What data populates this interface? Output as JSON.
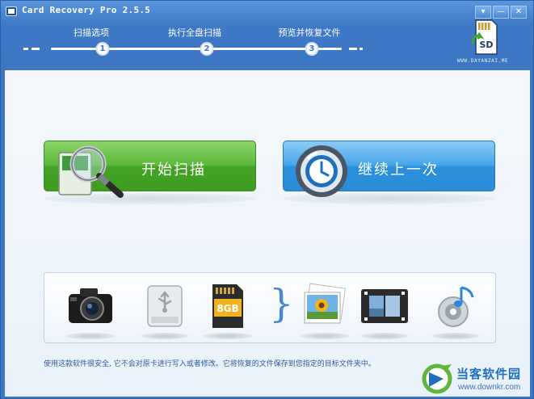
{
  "window": {
    "title": "Card Recovery Pro 2.5.5",
    "buttons": [
      "▾",
      "—",
      "✕"
    ]
  },
  "steps": [
    {
      "label": "扫描选项",
      "number": "1"
    },
    {
      "label": "执行全盘扫描",
      "number": "2"
    },
    {
      "label": "预览并恢复文件",
      "number": "3"
    }
  ],
  "header_logo": {
    "badge": "SD",
    "site": "WWW.DAYANZAI.ME"
  },
  "actions": {
    "start_scan_label": "开始扫描",
    "resume_label": "继续上一次"
  },
  "media_icons": [
    "camera-icon",
    "usb-drive-icon",
    "sd-card-icon",
    "photo-icon",
    "video-icon",
    "audio-icon"
  ],
  "sd_card_text": "8GB",
  "footnote": "使用这款软件很安全, 它不会对原卡进行写入或者修改。它将恢复的文件保存到您指定的目标文件夹中。",
  "watermark": {
    "name": "当客软件园",
    "url": "www.downkr.com"
  },
  "colors": {
    "frame": "#3e79c7",
    "scan_button": "#4caa2c",
    "resume_button": "#2f94de",
    "footnote_text": "#2d5aa0"
  }
}
